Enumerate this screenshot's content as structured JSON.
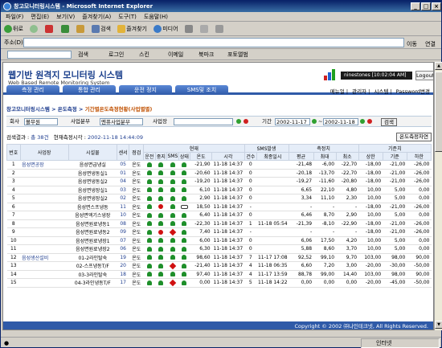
{
  "window": {
    "title": "창고모니터링시스템 - Microsoft Internet Explorer"
  },
  "menu": [
    "파일(F)",
    "편집(E)",
    "보기(V)",
    "즐겨찾기(A)",
    "도구(T)",
    "도움말(H)"
  ],
  "toolbar": {
    "back": "뒤로",
    "search": "검색",
    "favorites": "즐겨찾기",
    "media": "미디어"
  },
  "address": {
    "label": "주소(D)",
    "go": "이동",
    "links": "연결"
  },
  "linksbar": {
    "search": "검색",
    "logcome": "로그인",
    "scrap": "스킨",
    "email": "이메일",
    "bookmark": "북마크",
    "photo": "포토앨범"
  },
  "site": {
    "title": "웹기반 원격지 모니터링 시스템",
    "subtitle": "Web Based Remote Monitoring System",
    "user": "ninestones [10:02:04 AM]",
    "logout": "Logout"
  },
  "nav": [
    "측정 관리",
    "통합 관리",
    "운전 정지",
    "SMS및 조치"
  ],
  "sublinks": [
    "메뉴얼",
    "관리자",
    "시스템",
    "Password변경"
  ],
  "crumb": {
    "path": "창고모니터링시스템 > 온도측정 > ",
    "current": "기간별온도측정현황(사업별별)"
  },
  "filter": {
    "company_label": "회사",
    "company": "볼무원",
    "dept_label": "사업분부",
    "dept": "멘퓨사업분부",
    "site_label": "사업장",
    "period_label": "기간",
    "from": "2002-11-17",
    "to": "2002-11-18",
    "search": "검색"
  },
  "info": {
    "result_label": "검색결과 : ",
    "count": "총 38건",
    "time_label": "현재측정시각 : ",
    "time": "2002-11-18 14:44:09",
    "btn": "온도측정차연"
  },
  "headers": {
    "no": "번호",
    "site": "사업장",
    "facility": "시설물",
    "sensor": "센서",
    "check": "점검",
    "current": "현재",
    "run": "운전",
    "stop": "중지",
    "sms": "SMS",
    "state": "상태",
    "temp": "온도",
    "time": "시각",
    "sms_occ": "SMS발생",
    "cnt": "건수",
    "last": "최종일시",
    "measure": "측정치",
    "avg": "평균",
    "max": "최대",
    "min": "최소",
    "std": "기준치",
    "upper": "상한",
    "base": "기준",
    "lower": "하한"
  },
  "rows": [
    {
      "no": "1",
      "site": "음성면공장",
      "fac": "음성면급냉실",
      "sensor": "05",
      "chk": "온도",
      "run": "g",
      "stop": "g",
      "sms": "g",
      "st": "g",
      "temp": "-21,90",
      "time": "11-18 14:37",
      "cnt": "0",
      "last": "",
      "avg": "-21,48",
      "max": "-6,00",
      "min": "-22,70",
      "up": "-18,00",
      "base": "-21,00",
      "low": "-26,00"
    },
    {
      "no": "2",
      "site": "",
      "fac": "음성면냉동실1",
      "sensor": "01",
      "chk": "온도",
      "run": "g",
      "stop": "g",
      "sms": "g",
      "st": "g",
      "temp": "-20,60",
      "time": "11-18 14:37",
      "cnt": "0",
      "last": "",
      "avg": "-20,18",
      "max": "-13,70",
      "min": "-22,70",
      "up": "-18,00",
      "base": "-21,00",
      "low": "-26,00"
    },
    {
      "no": "3",
      "site": "",
      "fac": "음성면냉동실2",
      "sensor": "04",
      "chk": "온도",
      "run": "g",
      "stop": "g",
      "sms": "g",
      "st": "g",
      "temp": "-19,20",
      "time": "11-18 14:37",
      "cnt": "0",
      "last": "",
      "avg": "-19,27",
      "max": "-11,60",
      "min": "-20,80",
      "up": "-18,00",
      "base": "-21,00",
      "low": "-26,00"
    },
    {
      "no": "4",
      "site": "",
      "fac": "음성면냉장실1",
      "sensor": "03",
      "chk": "온도",
      "run": "g",
      "stop": "g",
      "sms": "g",
      "st": "g",
      "temp": "6,10",
      "time": "11-18 14:37",
      "cnt": "0",
      "last": "",
      "avg": "6,65",
      "max": "22,10",
      "min": "4,80",
      "up": "10,00",
      "base": "5,00",
      "low": "0,00"
    },
    {
      "no": "5",
      "site": "",
      "fac": "음성면냉장실2",
      "sensor": "02",
      "chk": "온도",
      "run": "g",
      "stop": "g",
      "sms": "g",
      "st": "g",
      "temp": "2,90",
      "time": "11-18 14:37",
      "cnt": "0",
      "last": "",
      "avg": "3,34",
      "max": "11,10",
      "min": "2,30",
      "up": "10,00",
      "base": "5,00",
      "low": "0,00"
    },
    {
      "no": "6",
      "site": "",
      "fac": "음성면스프냉동",
      "sensor": "11",
      "chk": "온도",
      "run": "g",
      "stop": "r",
      "sms": "g",
      "st": "p",
      "temp": "18,50",
      "time": "11-18 14:37",
      "cnt": "-",
      "last": "",
      "avg": "-",
      "max": "-",
      "min": "-",
      "up": "-18,00",
      "base": "-21,00",
      "low": "-26,00"
    },
    {
      "no": "7",
      "site": "",
      "fac": "음성면액기스냉장",
      "sensor": "10",
      "chk": "온도",
      "run": "g",
      "stop": "g",
      "sms": "g",
      "st": "g",
      "temp": "6,40",
      "time": "11-18 14:37",
      "cnt": "0",
      "last": "",
      "avg": "6,46",
      "max": "8,70",
      "min": "2,90",
      "up": "10,00",
      "base": "5,00",
      "low": "0,00"
    },
    {
      "no": "8",
      "site": "",
      "fac": "음성면원료냉동1",
      "sensor": "08",
      "chk": "온도",
      "run": "g",
      "stop": "g",
      "sms": "g",
      "st": "g",
      "temp": "-22,30",
      "time": "11-18 14:37",
      "cnt": "1",
      "last": "11-18 05:54",
      "avg": "-21,39",
      "max": "-8,10",
      "min": "-22,90",
      "up": "-18,00",
      "base": "-21,00",
      "low": "-26,00"
    },
    {
      "no": "9",
      "site": "",
      "fac": "음성면원료냉동2",
      "sensor": "09",
      "chk": "온도",
      "run": "g",
      "stop": "r",
      "sms": "w",
      "st": "g",
      "temp": "7,40",
      "time": "11-18 14:37",
      "cnt": "-",
      "last": "",
      "avg": "-",
      "max": "-",
      "min": "-",
      "up": "-18,00",
      "base": "-21,00",
      "low": "-26,00"
    },
    {
      "no": "10",
      "site": "",
      "fac": "음성면원료냉장1",
      "sensor": "07",
      "chk": "온도",
      "run": "g",
      "stop": "g",
      "sms": "g",
      "st": "g",
      "temp": "6,00",
      "time": "11-18 14:37",
      "cnt": "0",
      "last": "",
      "avg": "6,06",
      "max": "17,50",
      "min": "4,20",
      "up": "10,00",
      "base": "5,00",
      "low": "0,00"
    },
    {
      "no": "11",
      "site": "",
      "fac": "음성면원료냉장2",
      "sensor": "06",
      "chk": "온도",
      "run": "g",
      "stop": "g",
      "sms": "g",
      "st": "g",
      "temp": "6,30",
      "time": "11-18 14:37",
      "cnt": "0",
      "last": "",
      "avg": "5,88",
      "max": "8,60",
      "min": "3,70",
      "up": "10,00",
      "base": "5,00",
      "low": "0,00"
    },
    {
      "no": "12",
      "site": "음성생산설비",
      "fac": "01-2라인탈숙",
      "sensor": "19",
      "chk": "온도",
      "run": "g",
      "stop": "g",
      "sms": "g",
      "st": "g",
      "temp": "98,60",
      "time": "11-18 14:37",
      "cnt": "7",
      "last": "11-17 17:08",
      "avg": "92,52",
      "max": "99,10",
      "min": "9,70",
      "up": "103,00",
      "base": "98,00",
      "low": "90,00"
    },
    {
      "no": "13",
      "site": "",
      "fac": "02-스프냉동T/F",
      "sensor": "20",
      "chk": "온도",
      "run": "g",
      "stop": "g",
      "sms": "w",
      "st": "g",
      "temp": "-21,40",
      "time": "11-18 14:37",
      "cnt": "4",
      "last": "11-18 06:35",
      "avg": "6,60",
      "max": "7,20",
      "min": "3,00",
      "up": "-20,00",
      "base": "-30,00",
      "low": "-50,00"
    },
    {
      "no": "14",
      "site": "",
      "fac": "03-3라인탈숙",
      "sensor": "18",
      "chk": "온도",
      "run": "g",
      "stop": "g",
      "sms": "g",
      "st": "g",
      "temp": "97,40",
      "time": "11-18 14:37",
      "cnt": "4",
      "last": "11-17 13:59",
      "avg": "88,78",
      "max": "99,00",
      "min": "14,40",
      "up": "103,00",
      "base": "98,00",
      "low": "90,00"
    },
    {
      "no": "15",
      "site": "",
      "fac": "04-3라인냉동T/F",
      "sensor": "17",
      "chk": "온도",
      "run": "g",
      "stop": "g",
      "sms": "w",
      "st": "g",
      "temp": "0,00",
      "time": "11-18 14:37",
      "cnt": "5",
      "last": "11-18 14:22",
      "avg": "0,00",
      "max": "0,00",
      "min": "0,00",
      "up": "-20,00",
      "base": "-45,00",
      "low": "-50,00"
    }
  ],
  "footer": "Copyright © 2002 ㈜나인테크넷, All Rights Reserved.",
  "status": {
    "zone": "인터넷"
  }
}
